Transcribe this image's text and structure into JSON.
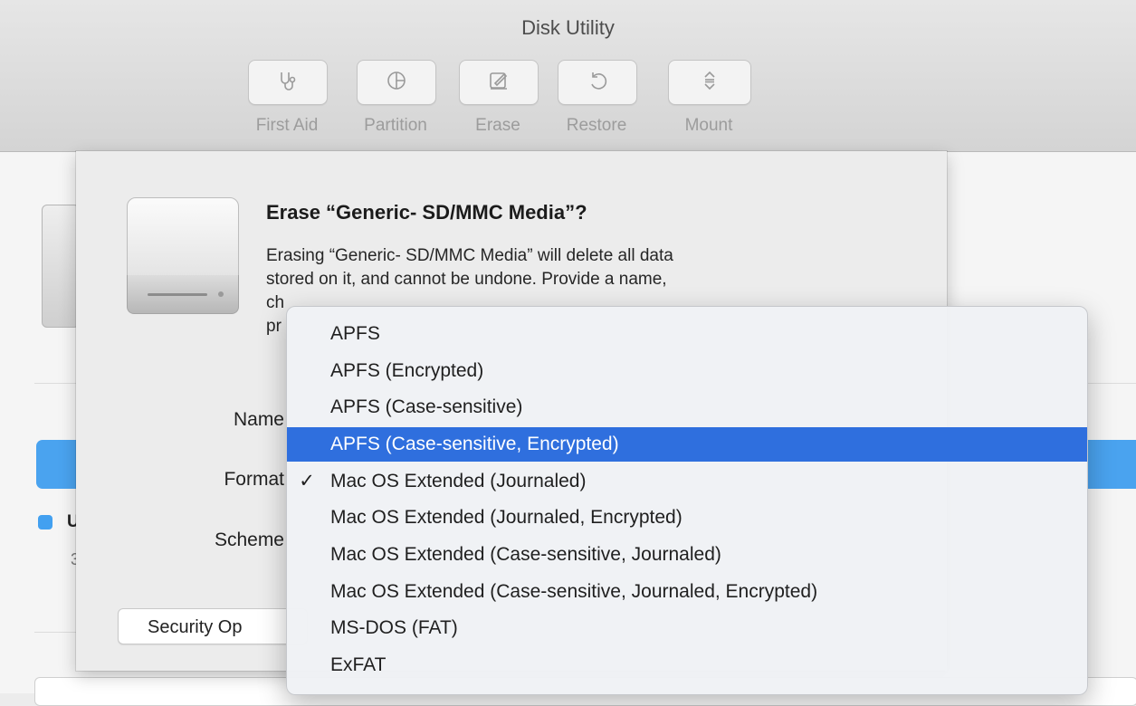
{
  "window": {
    "title": "Disk Utility"
  },
  "toolbar": {
    "items": [
      {
        "label": "First Aid",
        "icon": "stethoscope-icon"
      },
      {
        "label": "Partition",
        "icon": "pie-icon"
      },
      {
        "label": "Erase",
        "icon": "erase-icon"
      },
      {
        "label": "Restore",
        "icon": "restore-icon"
      },
      {
        "label": "Mount",
        "icon": "mount-icon"
      }
    ]
  },
  "background": {
    "sidebar_letter": "U",
    "sidebar_number": "3"
  },
  "sheet": {
    "title": "Erase “Generic- SD/MMC Media”?",
    "description_lines": [
      "Erasing “Generic- SD/MMC Media” will delete all data",
      "stored on it, and cannot be undone. Provide a name,",
      "ch",
      "pr"
    ],
    "name_label": "Name",
    "format_label": "Format",
    "scheme_label": "Scheme",
    "security_button": "Security Op"
  },
  "format_menu": {
    "selected_index": 3,
    "checked_index": 4,
    "check_glyph": "✓",
    "options": [
      "APFS",
      "APFS (Encrypted)",
      "APFS (Case-sensitive)",
      "APFS (Case-sensitive, Encrypted)",
      "Mac OS Extended (Journaled)",
      "Mac OS Extended (Journaled, Encrypted)",
      "Mac OS Extended (Case-sensitive, Journaled)",
      "Mac OS Extended (Case-sensitive, Journaled, Encrypted)",
      "MS-DOS (FAT)",
      "ExFAT"
    ]
  },
  "colors": {
    "highlight": "#2f6fde",
    "accent": "#4aa3ef"
  }
}
